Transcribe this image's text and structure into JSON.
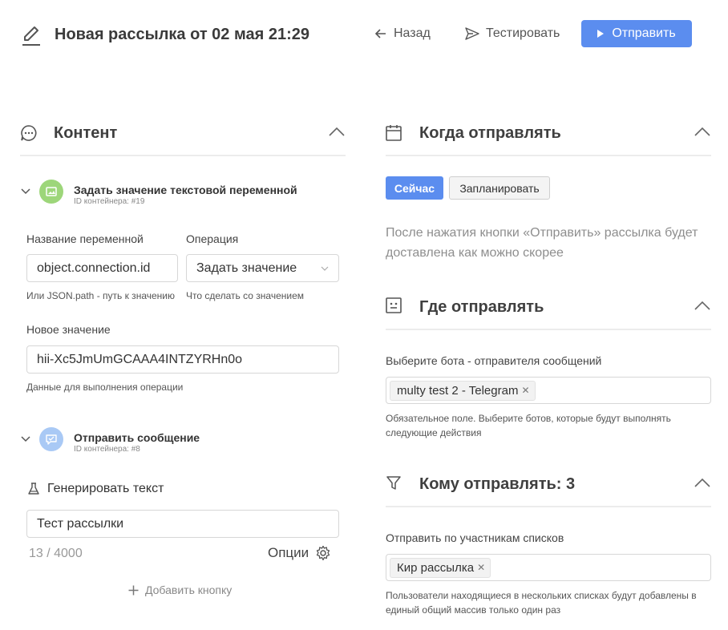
{
  "header": {
    "title": "Новая рассылка от 02 мая 21:29",
    "back_label": "Назад",
    "test_label": "Тестировать",
    "send_label": "Отправить",
    "accent": "#5b8def"
  },
  "content": {
    "title": "Контент",
    "containers": [
      {
        "title": "Задать значение текстовой переменной",
        "id_label": "ID контейнера: #19",
        "icon_color": "#9dd67a",
        "fields": {
          "var_name_label": "Название переменной",
          "var_name_value": "object.connection.id",
          "var_name_hint": "Или JSON.path - путь к значению",
          "operation_label": "Операция",
          "operation_value": "Задать значение",
          "operation_hint": "Что сделать со значением",
          "new_value_label": "Новое значение",
          "new_value_value": "hii-Xc5JmUmGCAAA4INTZYRHn0o",
          "new_value_hint": "Данные для выполнения операции"
        }
      },
      {
        "title": "Отправить сообщение",
        "id_label": "ID контейнера: #8",
        "icon_color": "#a9c9f5",
        "fields": {
          "generate_label": "Генерировать текст",
          "message_value": "Тест рассылки",
          "counter": "13 / 4000",
          "options_label": "Опции",
          "add_button_label": "Добавить кнопку"
        }
      }
    ]
  },
  "when": {
    "title": "Когда отправлять",
    "now_label": "Сейчас",
    "schedule_label": "Запланировать",
    "description": "После нажатия кнопки «Отправить» рассылка будет доставлена как можно скорее"
  },
  "where": {
    "title": "Где отправлять",
    "label": "Выберите бота - отправителя сообщений",
    "chip": "multy test 2 - Telegram",
    "hint": "Обязательное поле. Выберите ботов, которые будут выполнять следующие действия"
  },
  "whom": {
    "title": "Кому отправлять: 3",
    "label": "Отправить по участникам списков",
    "chip": "Кир рассылка",
    "hint": "Пользователи находящиеся в нескольких списках будут добавлены в единый общий массив только один раз"
  },
  "icons": {
    "edit": "pencil-icon",
    "back": "arrow-left-icon",
    "test": "paper-plane-icon",
    "send": "play-icon",
    "content": "chat-bubble-icon",
    "when": "calendar-icon",
    "where": "bot-face-icon",
    "whom": "funnel-icon",
    "collapse": "chevron-up-icon",
    "expand": "chevron-down-icon",
    "flask": "flask-icon",
    "gear": "gear-icon",
    "plus": "plus-icon"
  }
}
